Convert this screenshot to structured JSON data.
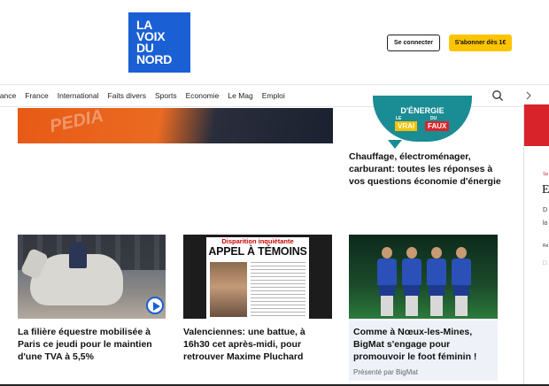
{
  "header": {
    "logo": [
      "LA",
      "VOIX",
      "DU",
      "NORD"
    ],
    "login_label": "Se connecter",
    "subscribe_label": "S'abonner dès 1€"
  },
  "nav": {
    "items": [
      "rance",
      "France",
      "International",
      "Faits divers",
      "Sports",
      "Economie",
      "Le Mag",
      "Emploi"
    ]
  },
  "hero": {
    "image_text": "PEDIA",
    "vrai_faux": {
      "top": "D'ÉNERGIE",
      "le": "LE",
      "du": "DU",
      "vrai": "VRAI",
      "faux": "FAUX"
    },
    "energy_headline": "Chauffage, électroménager, carburant: toutes les réponses à vos questions économie d'énergie"
  },
  "cards": [
    {
      "title": "La filière équestre mobilisée à Paris ce jeudi pour le maintien d'une TVA à 5,5%"
    },
    {
      "title": "Valenciennes: une battue, à 16h30 cet après-midi, pour retrouver Maxime Pluchard",
      "poster_tag": "Disparition inquiétante",
      "poster_title": "APPEL À TÉMOINS"
    },
    {
      "title": "Comme à Nœux-les-Mines, BigMat s'engage pour promouvoir le foot féminin !",
      "sponsor": "Présenté par BigMat"
    }
  ],
  "sidebar": {
    "category": "Sp",
    "title": "E",
    "line1": "D",
    "line2": "lo",
    "line3": "Ré",
    "line4": "□"
  },
  "colors": {
    "brand_blue": "#1a5fd4",
    "subscribe_yellow": "#ffc400",
    "alert_red": "#d8232a"
  }
}
